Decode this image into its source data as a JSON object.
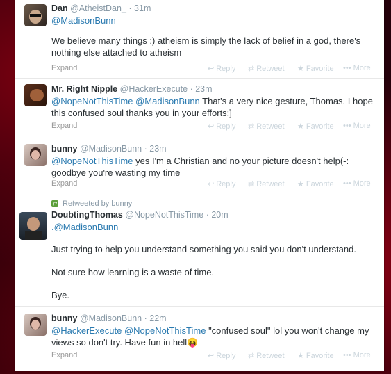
{
  "tweets": [
    {
      "name": "Dan",
      "handle": "@AtheistDan_",
      "time": "31m",
      "mention_line": "@MadisonBunn",
      "text": "We believe many things :) atheism is simply the lack of belief in a god, there's nothing else attached to atheism",
      "expand": "Expand"
    },
    {
      "name": "Mr. Right Nipple",
      "handle": "@HackerExecute",
      "time": "23m",
      "mentions": "@NopeNotThisTime @MadisonBunn",
      "text": "That's a very nice gesture, Thomas. I hope this confused soul thanks you in your efforts:]",
      "expand": "Expand"
    },
    {
      "name": "bunny",
      "handle": "@MadisonBunn",
      "time": "23m",
      "mentions": "@NopeNotThisTime",
      "text": "yes I'm a Christian and no your picture doesn't help(-: goodbye you're wasting my time",
      "expand": "Expand"
    },
    {
      "retweet_note": "Retweeted by bunny",
      "name": "DoubtingThomas",
      "handle": "@NopeNotThisTime",
      "time": "20m",
      "mention_line": ".@MadisonBunn",
      "para1": "Just trying to help you understand something you said you don't understand.",
      "para2": "Not sure how learning is a waste of time.",
      "para3": "Bye."
    },
    {
      "name": "bunny",
      "handle": "@MadisonBunn",
      "time": "22m",
      "mentions": "@HackerExecute @NopeNotThisTime",
      "text": "\"confused soul\" lol you won't change my views so don't try. Have fun in hell😝",
      "expand": "Expand"
    }
  ],
  "actions": {
    "reply": "Reply",
    "retweet": "Retweet",
    "favorite": "Favorite",
    "more": "More"
  },
  "icons": {
    "reply": "reply-arrow-icon",
    "retweet": "retweet-icon",
    "favorite": "star-icon",
    "more": "dots-icon"
  },
  "colors": {
    "link": "#2a7ab0",
    "muted": "#8899a6"
  }
}
